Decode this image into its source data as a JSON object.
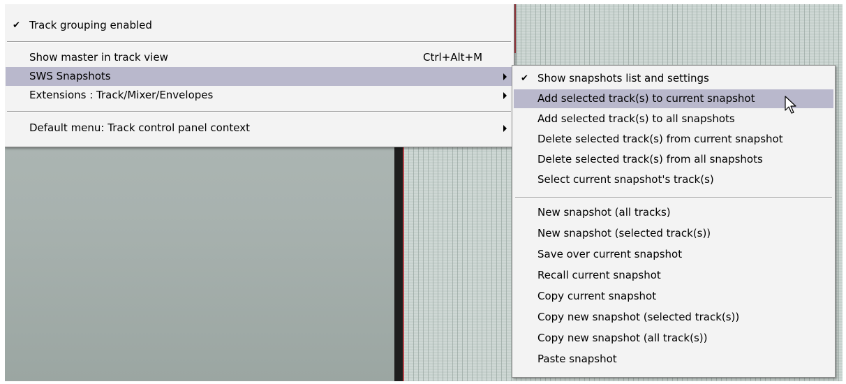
{
  "main_menu": {
    "items": [
      {
        "label": "Track grouping enabled",
        "checked": true
      },
      {
        "label": "Show master in track view",
        "shortcut": "Ctrl+Alt+M"
      },
      {
        "label": "SWS Snapshots",
        "submenu": true,
        "highlighted": true
      },
      {
        "label": "Extensions : Track/Mixer/Envelopes",
        "submenu": true
      },
      {
        "label": "Default menu: Track control panel context",
        "submenu": true
      }
    ]
  },
  "snapshots_menu": {
    "items": [
      {
        "label": "Show snapshots list and settings",
        "checked": true
      },
      {
        "label": "Add selected track(s) to current snapshot",
        "highlighted": true
      },
      {
        "label": "Add selected track(s) to all snapshots"
      },
      {
        "label": "Delete selected track(s) from current snapshot"
      },
      {
        "label": "Delete selected track(s) from all snapshots"
      },
      {
        "label": "Select current snapshot's track(s)"
      },
      {
        "label": "New snapshot (all tracks)"
      },
      {
        "label": "New snapshot (selected track(s))"
      },
      {
        "label": "Save over current snapshot"
      },
      {
        "label": "Recall current snapshot"
      },
      {
        "label": "Copy current snapshot"
      },
      {
        "label": "Copy new snapshot (selected track(s))"
      },
      {
        "label": "Copy new snapshot (all track(s))"
      },
      {
        "label": "Paste snapshot"
      }
    ]
  },
  "glyphs": {
    "check": "✔"
  },
  "colors": {
    "highlight": "#b9b8cc",
    "menu_bg": "#f3f3f3",
    "track_divider_red": "#b8434a"
  },
  "icons": {
    "cursor": "arrow-pointer-icon",
    "check": "checkmark-icon",
    "submenu": "submenu-arrow-icon"
  }
}
